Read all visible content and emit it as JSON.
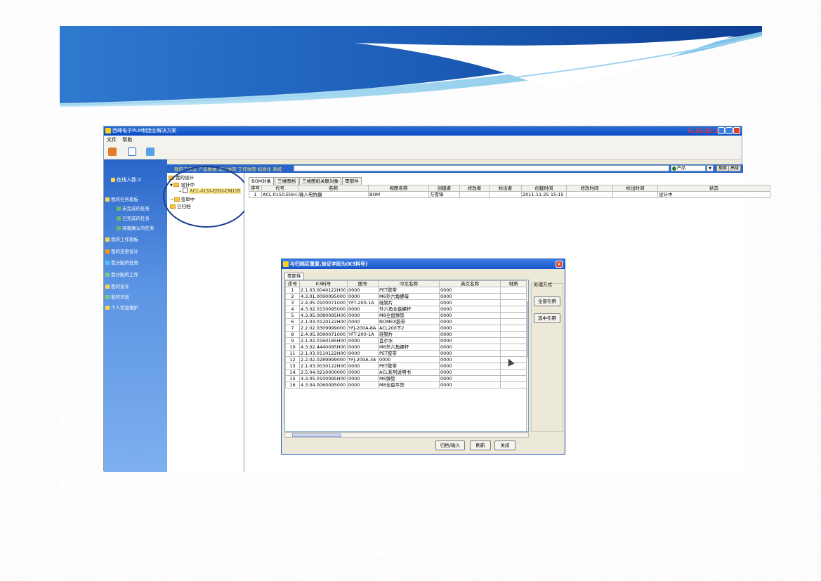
{
  "app": {
    "title": "西峰电子PLM制造业解决方案",
    "clock": "6:33/26:18",
    "menu": [
      "文件",
      "帮助"
    ],
    "toolbar_icons": [
      "user-icon",
      "mail-icon",
      "users-icon"
    ]
  },
  "sidebar": {
    "online": "在线人数:2",
    "items": [
      {
        "label": "我的任务看板",
        "icon": "task-board-icon",
        "color": "#ffd54a"
      },
      {
        "label": "未完成的任务",
        "icon": "pending-task-icon",
        "color": "#66bb6a"
      },
      {
        "label": "已完成的任务",
        "icon": "done-task-icon",
        "color": "#66bb6a"
      },
      {
        "label": "待我确认的任务",
        "icon": "confirm-task-icon",
        "color": "#66bb6a"
      },
      {
        "label": "我的工作看板",
        "icon": "work-board-icon",
        "color": "#ffd54a"
      },
      {
        "label": "我的变更设计",
        "icon": "change-design-icon",
        "color": "#ff9800"
      },
      {
        "label": "我分配的任务",
        "icon": "assigned-task-icon",
        "color": "#4fc3f7"
      },
      {
        "label": "我分配的工作",
        "icon": "assigned-work-icon",
        "color": "#81c784"
      },
      {
        "label": "我的设计",
        "icon": "my-design-icon",
        "color": "#ffd54a"
      },
      {
        "label": "我的消息",
        "icon": "message-icon",
        "color": "#81c784"
      },
      {
        "label": "个人信息维护",
        "icon": "profile-icon",
        "color": "#ffd54a"
      }
    ]
  },
  "nav": {
    "links": "我的工作室 产品数据 设计协同 工作协同 标准化 系统",
    "product_select": "产品",
    "search_btn": "搜索",
    "advanced_btn": "高级"
  },
  "tree": {
    "root": "我的设计",
    "nodes": [
      "设计中",
      "ACL-0150-EISH-EM11B",
      "签审中",
      "已归档"
    ]
  },
  "main": {
    "tabs": [
      "BOM对象",
      "三维图档",
      "三维图纸关联对象",
      "零部件"
    ],
    "columns": [
      "序号",
      "代号",
      "名称",
      "视图名称",
      "创建者",
      "修改者",
      "检出者",
      "创建时间",
      "修改时间",
      "检出时间",
      "状态"
    ],
    "rows": [
      [
        "1",
        "ACL.0150.EISH.E...",
        "输入电抗器",
        "BOM",
        "万雪锋",
        "",
        "",
        "2011-11-25 15:15",
        "",
        "",
        "设计中"
      ]
    ]
  },
  "dialog": {
    "title": "与归档区重复,验证字段为(K3料号)",
    "tab": "零部件",
    "columns": [
      "序号",
      "K3料号",
      "图号",
      "中文名称",
      "英文名称",
      "材质"
    ],
    "rows": [
      [
        "1",
        "2.1.03.0040122H00",
        "0000",
        "PET胶带",
        "0000",
        ""
      ],
      [
        "2",
        "4.3.01.0090095000",
        "0000",
        "M6外六角螺母",
        "0000",
        ""
      ],
      [
        "3",
        "2.4.05.0100071000",
        "YFT-200-1A",
        "硅钢片",
        "0000",
        ""
      ],
      [
        "4",
        "4.3.02.0150095000",
        "0000",
        "外六角全盘螺杆",
        "0000",
        ""
      ],
      [
        "5",
        "4.3.05.0080095H00",
        "0000",
        "M8全盘弹垫",
        "0000",
        ""
      ],
      [
        "6",
        "2.1.03.0120122H00",
        "0000",
        "NOMEX胶带",
        "0000",
        ""
      ],
      [
        "7",
        "2.2.02.0309999000",
        "YFJ-200A-8A",
        "ACL200下2",
        "0000",
        ""
      ],
      [
        "8",
        "2.4.05.0090071000",
        "YFT-200-1A",
        "硅钢片",
        "0000",
        ""
      ],
      [
        "9",
        "2.1.02.0160185H00",
        "0000",
        "瓦尔水",
        "0000",
        ""
      ],
      [
        "10",
        "4.3.02.4440095H00",
        "0000",
        "M6外六角螺杆",
        "0000",
        ""
      ],
      [
        "11",
        "2.1.03.0110122H00",
        "0000",
        "PET胶带",
        "0000",
        ""
      ],
      [
        "12",
        "2.2.02.0289999000",
        "YFJ-200A-3A",
        "0000",
        "0000",
        ""
      ],
      [
        "13",
        "2.1.03.0030122H00",
        "0000",
        "PET胶带",
        "0000",
        ""
      ],
      [
        "14",
        "2.5.04.0210000000",
        "0000",
        "ACL系列说明书",
        "0000",
        ""
      ],
      [
        "15",
        "4.3.05.0100095H00",
        "0000",
        "M6弹垫",
        "0000",
        ""
      ],
      [
        "16",
        "4.3.04.0060095000",
        "0000",
        "M8全盘平垫",
        "0000",
        ""
      ]
    ],
    "group_label": "处理方式",
    "btn_all": "全部引用",
    "btn_selected": "选中引用",
    "btn_archive": "归档/输入",
    "btn_refresh": "刷新",
    "btn_close": "关闭"
  }
}
